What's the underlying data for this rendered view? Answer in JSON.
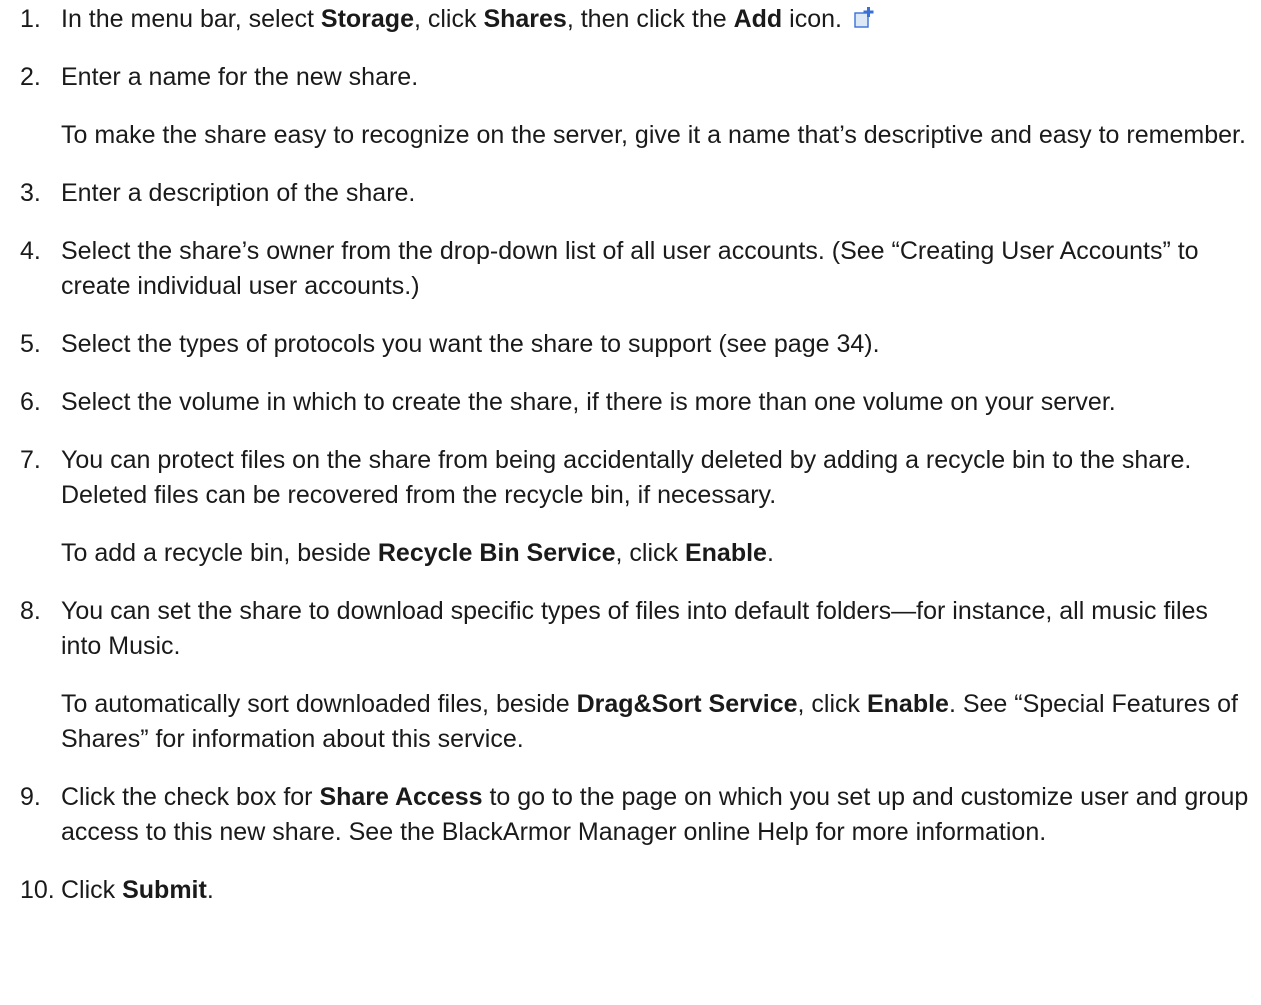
{
  "steps": [
    {
      "num": "1.",
      "segments": [
        {
          "t": "In the menu bar, select "
        },
        {
          "t": "Storage",
          "b": true
        },
        {
          "t": ", click "
        },
        {
          "t": "Shares",
          "b": true
        },
        {
          "t": ", then click the "
        },
        {
          "t": "Add",
          "b": true
        },
        {
          "t": " icon. "
        },
        {
          "icon": "add-share-icon"
        }
      ]
    },
    {
      "num": "2.",
      "segments": [
        {
          "t": "Enter a name for the new share."
        }
      ],
      "sub": [
        {
          "segments": [
            {
              "t": "To make the share easy to recognize on the server, give it a name that’s descriptive and easy to remember."
            }
          ]
        }
      ]
    },
    {
      "num": "3.",
      "segments": [
        {
          "t": "Enter a description of the share."
        }
      ]
    },
    {
      "num": "4.",
      "segments": [
        {
          "t": "Select the share’s owner from the drop-down list of all user accounts. (See “Creating User Accounts” to create individual user accounts.)"
        }
      ]
    },
    {
      "num": "5.",
      "segments": [
        {
          "t": "Select the types of protocols you want the share to support (see page 34)."
        }
      ]
    },
    {
      "num": "6.",
      "segments": [
        {
          "t": "Select the volume in which to create the share, if there is more than one volume on your server."
        }
      ]
    },
    {
      "num": "7.",
      "segments": [
        {
          "t": "You can protect files on the share from being accidentally deleted by adding a recycle bin to the share. Deleted files can be recovered from the recycle bin, if necessary."
        }
      ],
      "sub": [
        {
          "segments": [
            {
              "t": "To add a recycle bin, beside "
            },
            {
              "t": "Recycle Bin Service",
              "b": true
            },
            {
              "t": ", click "
            },
            {
              "t": "Enable",
              "b": true
            },
            {
              "t": "."
            }
          ]
        }
      ]
    },
    {
      "num": "8.",
      "segments": [
        {
          "t": "You can set the share to download specific types of files into default folders—for instance, all music files into Music."
        }
      ],
      "sub": [
        {
          "segments": [
            {
              "t": "To automatically sort downloaded files, beside "
            },
            {
              "t": "Drag&Sort Service",
              "b": true
            },
            {
              "t": ", click "
            },
            {
              "t": "Enable",
              "b": true
            },
            {
              "t": ". See “Special Features of Shares” for information about this service."
            }
          ]
        }
      ]
    },
    {
      "num": "9.",
      "segments": [
        {
          "t": "Click the check box for "
        },
        {
          "t": "Share Access",
          "b": true
        },
        {
          "t": " to go to the page on which you set up and customize user and group access to this new share. See the BlackArmor Manager online Help for more information."
        }
      ]
    },
    {
      "num": "10.",
      "segments": [
        {
          "t": "Click "
        },
        {
          "t": "Submit",
          "b": true
        },
        {
          "t": "."
        }
      ]
    }
  ],
  "colors": {
    "text": "#1a1a1a",
    "icon_blue": "#3a6fd8",
    "icon_page": "#dde8f7"
  }
}
